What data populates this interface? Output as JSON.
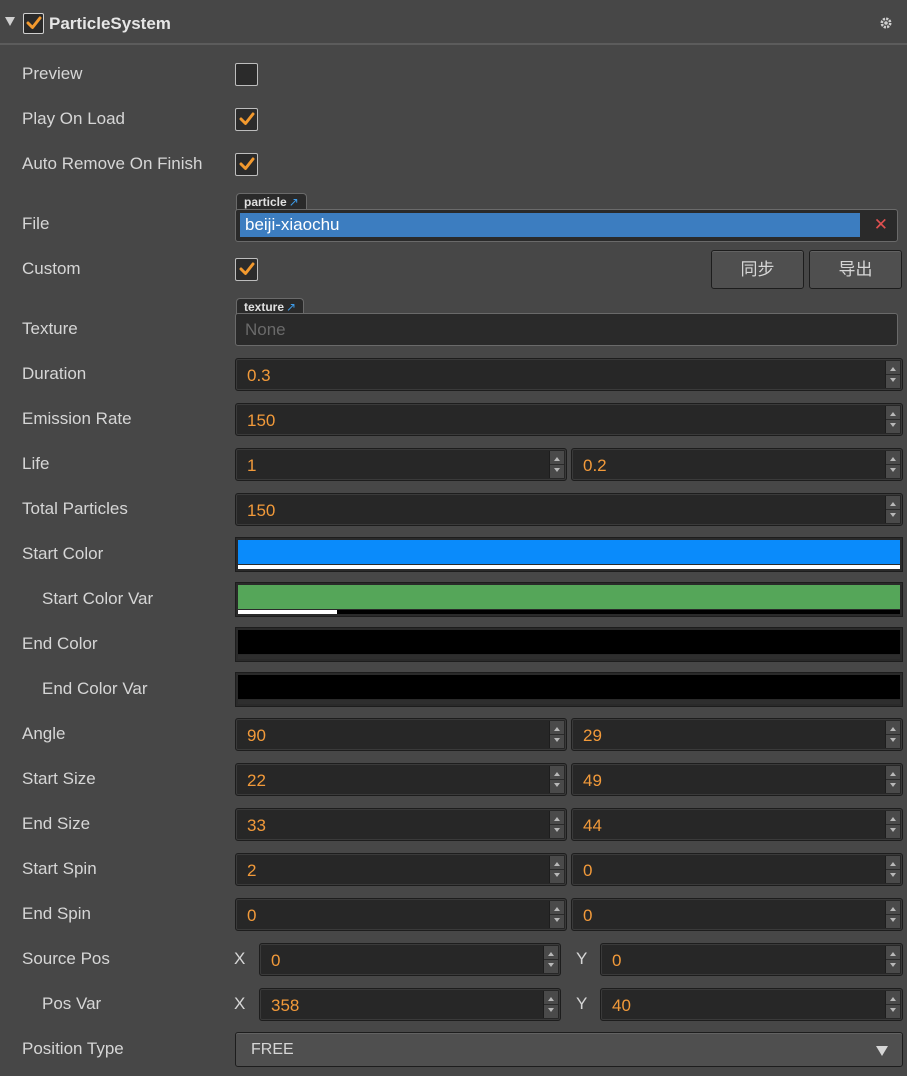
{
  "component": {
    "title": "ParticleSystem",
    "enabled": true
  },
  "labels": {
    "preview": "Preview",
    "play_on_load": "Play On Load",
    "auto_remove": "Auto Remove On Finish",
    "file": "File",
    "custom": "Custom",
    "texture": "Texture",
    "duration": "Duration",
    "emission_rate": "Emission Rate",
    "life": "Life",
    "total_particles": "Total Particles",
    "start_color": "Start Color",
    "start_color_var": "Start Color Var",
    "end_color": "End Color",
    "end_color_var": "End Color Var",
    "angle": "Angle",
    "start_size": "Start Size",
    "end_size": "End Size",
    "start_spin": "Start Spin",
    "end_spin": "End Spin",
    "source_pos": "Source Pos",
    "pos_var": "Pos Var",
    "position_type": "Position Type"
  },
  "checks": {
    "preview": false,
    "play_on_load": true,
    "auto_remove": true,
    "custom": true
  },
  "file": {
    "tag": "particle",
    "value": "beiji-xiaochu"
  },
  "texture": {
    "tag": "texture",
    "value": "None"
  },
  "buttons": {
    "sync": "同步",
    "export": "导出"
  },
  "values": {
    "duration": "0.3",
    "emission_rate": "150",
    "life": "1",
    "life_var": "0.2",
    "total_particles": "150",
    "angle": "90",
    "angle_var": "29",
    "start_size": "22",
    "start_size_var": "49",
    "end_size": "33",
    "end_size_var": "44",
    "start_spin": "2",
    "start_spin_var": "0",
    "end_spin": "0",
    "end_spin_var": "0",
    "source_pos_x": "0",
    "source_pos_y": "0",
    "pos_var_x": "358",
    "pos_var_y": "40"
  },
  "axes": {
    "x": "X",
    "y": "Y"
  },
  "colors": {
    "start_color": "#0a8bfb",
    "start_color_var": "#55a659",
    "end_color": "#000000",
    "end_color_var": "#000000",
    "checkmark": "#f2992e",
    "file_highlight": "#3c7dc0"
  },
  "alphas": {
    "start_color": 1.0,
    "start_color_var": 0.15,
    "end_color": 0.0,
    "end_color_var": 0.0
  },
  "position_type": {
    "selected": "FREE"
  },
  "icons": {
    "collapse": "triangle-down-icon",
    "settings": "gear-icon",
    "external": "external-link-icon",
    "clear": "close-icon"
  }
}
